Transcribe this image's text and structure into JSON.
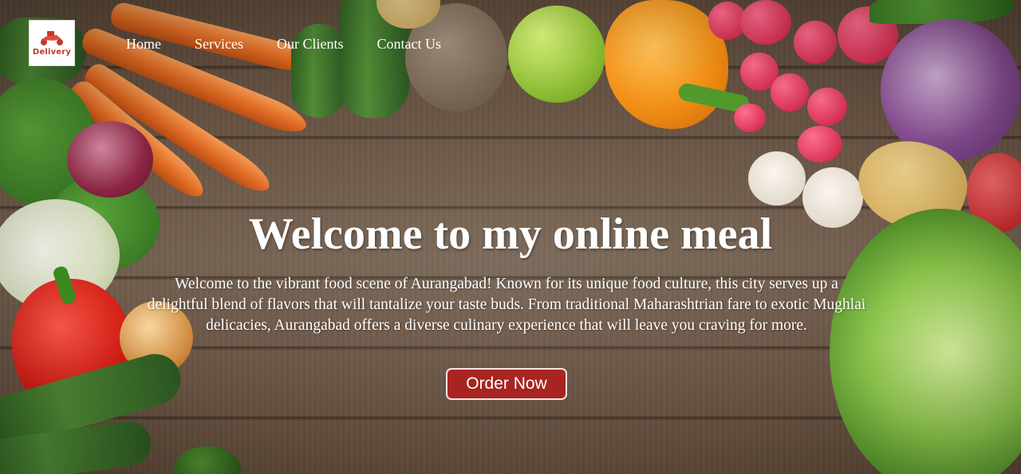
{
  "brand": {
    "logo_text": "Delivery",
    "accent_color": "#a82420"
  },
  "nav": {
    "items": [
      {
        "label": "Home"
      },
      {
        "label": "Services"
      },
      {
        "label": "Our Clients"
      },
      {
        "label": "Contact Us"
      }
    ]
  },
  "hero": {
    "title": "Welcome to my online meal",
    "description": "Welcome to the vibrant food scene of Aurangabad! Known for its unique food culture, this city serves up a delightful blend of flavors that will tantalize your taste buds. From traditional Maharashtrian fare to exotic Mughlai delicacies, Aurangabad offers a diverse culinary experience that will leave you craving for more.",
    "cta_label": "Order Now"
  },
  "icons": {
    "logo": "scooter-delivery-icon"
  }
}
